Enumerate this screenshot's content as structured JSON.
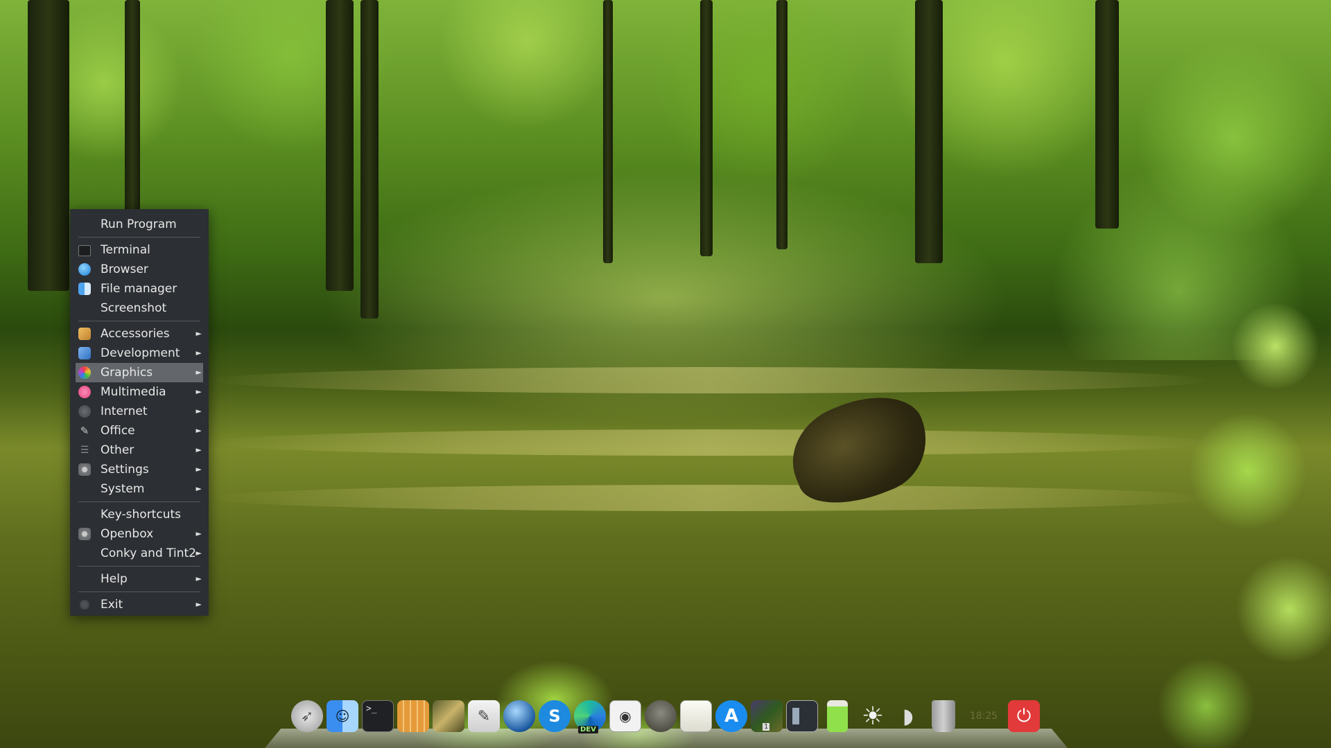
{
  "menu": {
    "items": [
      {
        "label": "Run Program"
      },
      {
        "label": "Terminal"
      },
      {
        "label": "Browser"
      },
      {
        "label": "File manager"
      },
      {
        "label": "Screenshot"
      },
      {
        "label": "Accessories"
      },
      {
        "label": "Development"
      },
      {
        "label": "Graphics"
      },
      {
        "label": "Multimedia"
      },
      {
        "label": "Internet"
      },
      {
        "label": "Office"
      },
      {
        "label": "Other"
      },
      {
        "label": "Settings"
      },
      {
        "label": "System"
      },
      {
        "label": "Key-shortcuts"
      },
      {
        "label": "Openbox"
      },
      {
        "label": "Conky and Tint2"
      },
      {
        "label": "Help"
      },
      {
        "label": "Exit"
      }
    ],
    "submenu_arrow": "►",
    "active_item": "Graphics"
  },
  "dock": {
    "icons": [
      "launchpad-icon",
      "finder-icon",
      "terminal-icon",
      "calculator-icon",
      "archive-icon",
      "text-editor-icon",
      "web-browser-icon",
      "skype-icon",
      "edge-dev-icon",
      "screenshot-icon",
      "gimp-icon",
      "notes-icon",
      "app-store-icon",
      "workspace-switcher-icon",
      "window-icon",
      "battery-icon",
      "brightness-icon",
      "volume-icon",
      "trash-icon",
      "power-icon"
    ],
    "edge_badge": "DEV",
    "workspace_number": "1",
    "clock": "18:25",
    "colors": {
      "skype": "#1d8ae0",
      "appstore": "#1a8cf0",
      "power": "#e23a3a"
    }
  }
}
